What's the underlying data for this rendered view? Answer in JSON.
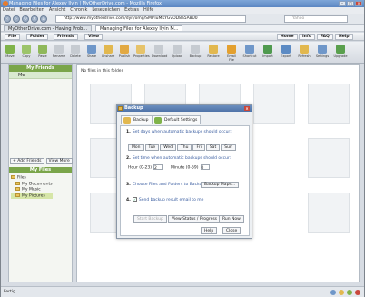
{
  "window": {
    "title": "Managing Files for Alexey Ilyin | MyOtherDrive.com - Mozilla Firefox"
  },
  "menu": [
    "Datei",
    "Bearbeiten",
    "Ansicht",
    "Chronik",
    "Lesezeichen",
    "Extras",
    "Hilfe"
  ],
  "nav": {
    "url": "http://www.myotherdrive.com/dyn/omg/SMPTuMKYGvOD8a5A8U0",
    "search_placeholder": "Yahoo"
  },
  "tabs": [
    "MyOtherDrive.com - Having Prob...",
    "Managing Files for Alexey Ilyin M..."
  ],
  "toolbar": {
    "file": "File",
    "folder": "Folder",
    "friends": "Friends",
    "view": "View",
    "home": "Home",
    "info": "Info",
    "faq": "FAQ",
    "help": "Help"
  },
  "ribbon": [
    "Move",
    "Copy",
    "Paste",
    "Rename",
    "Delete",
    "Share",
    "Unshare",
    "Publish",
    "Properties",
    "Download",
    "Upload",
    "Backup",
    "Restore",
    "Email File",
    "Shortcut",
    "Import",
    "Export",
    "Refresh",
    "Settings",
    "Upgrade"
  ],
  "left": {
    "friends_header": "My Friends",
    "me": "Me",
    "add_friends": "+ Add Friends",
    "view_more": "View More",
    "files_header": "My Files",
    "tree": [
      "Files",
      "My Documents",
      "My Music",
      "My Pictures"
    ]
  },
  "main": {
    "empty_msg": "No files in this folder."
  },
  "dialog": {
    "title": "Backup",
    "tab_backup": "Backup",
    "tab_settings": "Default Settings",
    "step1_num": "1.",
    "step1": "Set days when automatic backups should occur:",
    "days": [
      "Mon",
      "Tue",
      "Wed",
      "Thu",
      "Fri",
      "Sat",
      "Sun"
    ],
    "step2_num": "2.",
    "step2": "Set time when automatic backups should occur:",
    "hour_label": "Hour (0-23)",
    "hour_value": "2",
    "minute_label": "Minute (0-59)",
    "minute_value": "0",
    "step3_num": "3.",
    "step3": "Choose Files and Folders to Backup:",
    "backup_maps": "Backup Maps...",
    "step4_num": "4.",
    "step4": "Send backup result email to me",
    "start_backup": "Start Backup",
    "view_status": "View Status / Progress",
    "run_now": "Run Now",
    "help": "Help",
    "close": "Close"
  },
  "status": {
    "text": "Fertig"
  },
  "colors": {
    "accent_green": "#7aa54a",
    "title_blue": "#4f73a8"
  }
}
